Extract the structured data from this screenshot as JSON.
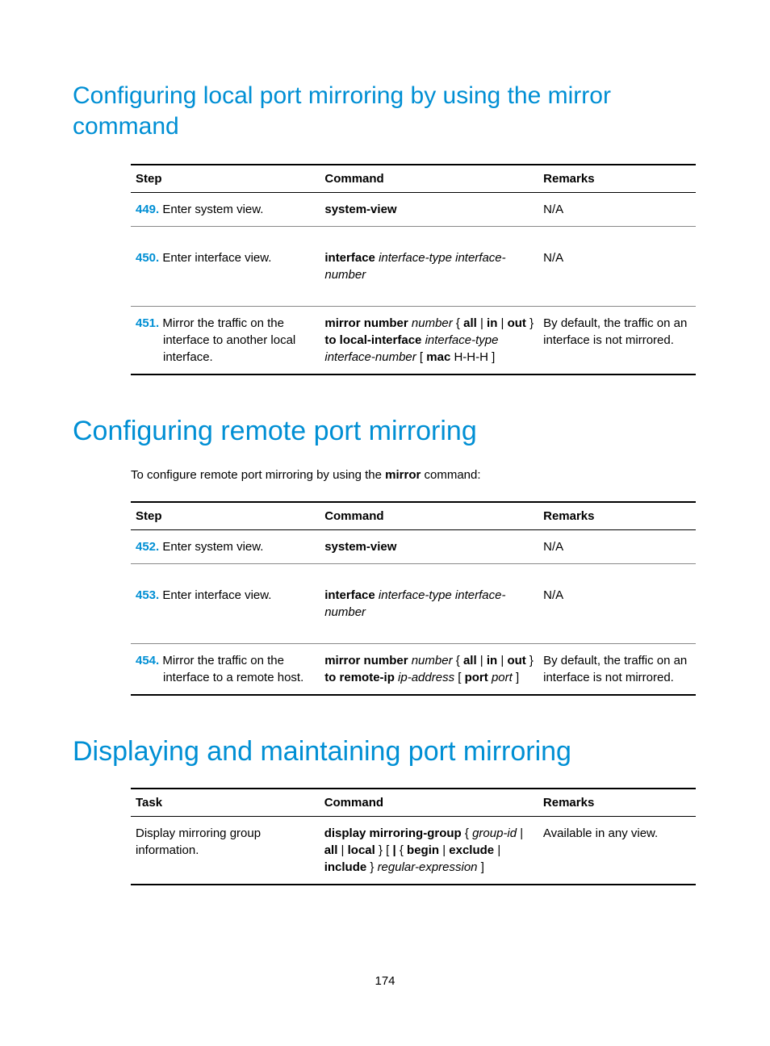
{
  "section1": {
    "title": "Configuring local port mirroring by using the mirror command",
    "headers": {
      "step": "Step",
      "command": "Command",
      "remarks": "Remarks"
    },
    "rows": [
      {
        "num": "449.",
        "step": "Enter system view.",
        "cmd_html": "<span class=\"b\">system-view</span>",
        "remarks": "N/A",
        "tall": false
      },
      {
        "num": "450.",
        "step": "Enter interface view.",
        "cmd_html": "<span class=\"b\">interface</span> <span class=\"i\">interface-type interface-number</span>",
        "remarks": "N/A",
        "tall": true
      },
      {
        "num": "451.",
        "step": "Mirror the traffic on the interface to another local interface.",
        "cmd_html": "<span class=\"b\">mirror number</span> <span class=\"i\">number</span> { <span class=\"b\">all</span> | <span class=\"b\">in</span> | <span class=\"b\">out</span> } <span class=\"b\">to local-interface</span> <span class=\"i\">interface-type interface-number</span> [ <span class=\"b\">mac</span> H-H-H ]",
        "remarks": "By default, the traffic on an interface is not mirrored.",
        "tall": false
      }
    ]
  },
  "section2": {
    "title": "Configuring remote port mirroring",
    "intro_pre": "To configure remote port mirroring by using the ",
    "intro_bold": "mirror",
    "intro_post": " command:",
    "headers": {
      "step": "Step",
      "command": "Command",
      "remarks": "Remarks"
    },
    "rows": [
      {
        "num": "452.",
        "step": "Enter system view.",
        "cmd_html": "<span class=\"b\">system-view</span>",
        "remarks": "N/A",
        "tall": false
      },
      {
        "num": "453.",
        "step": "Enter interface view.",
        "cmd_html": "<span class=\"b\">interface</span> <span class=\"i\">interface-type interface-number</span>",
        "remarks": "N/A",
        "tall": true
      },
      {
        "num": "454.",
        "step": "Mirror the traffic on the interface to a remote host.",
        "cmd_html": "<span class=\"b\">mirror number</span> <span class=\"i\">number</span> { <span class=\"b\">all</span> | <span class=\"b\">in</span> | <span class=\"b\">out</span> } <span class=\"b\">to remote-ip</span> <span class=\"i\">ip-address</span> [ <span class=\"b\">port</span> <span class=\"i\">port</span> ]",
        "remarks": "By default, the traffic on an interface is not mirrored.",
        "tall": false
      }
    ]
  },
  "section3": {
    "title": "Displaying and maintaining port mirroring",
    "headers": {
      "task": "Task",
      "command": "Command",
      "remarks": "Remarks"
    },
    "rows": [
      {
        "task": "Display mirroring group information.",
        "cmd_html": "<span class=\"b\">display mirroring-group</span> { <span class=\"i\">group-id</span> | <span class=\"b\">all</span> | <span class=\"b\">local</span> } [ <span class=\"b\">|</span> { <span class=\"b\">begin</span> | <span class=\"b\">exclude</span> | <span class=\"b\">include</span> } <span class=\"i\">regular-expression</span> ]",
        "remarks": "Available in any view."
      }
    ]
  },
  "page_number": "174"
}
